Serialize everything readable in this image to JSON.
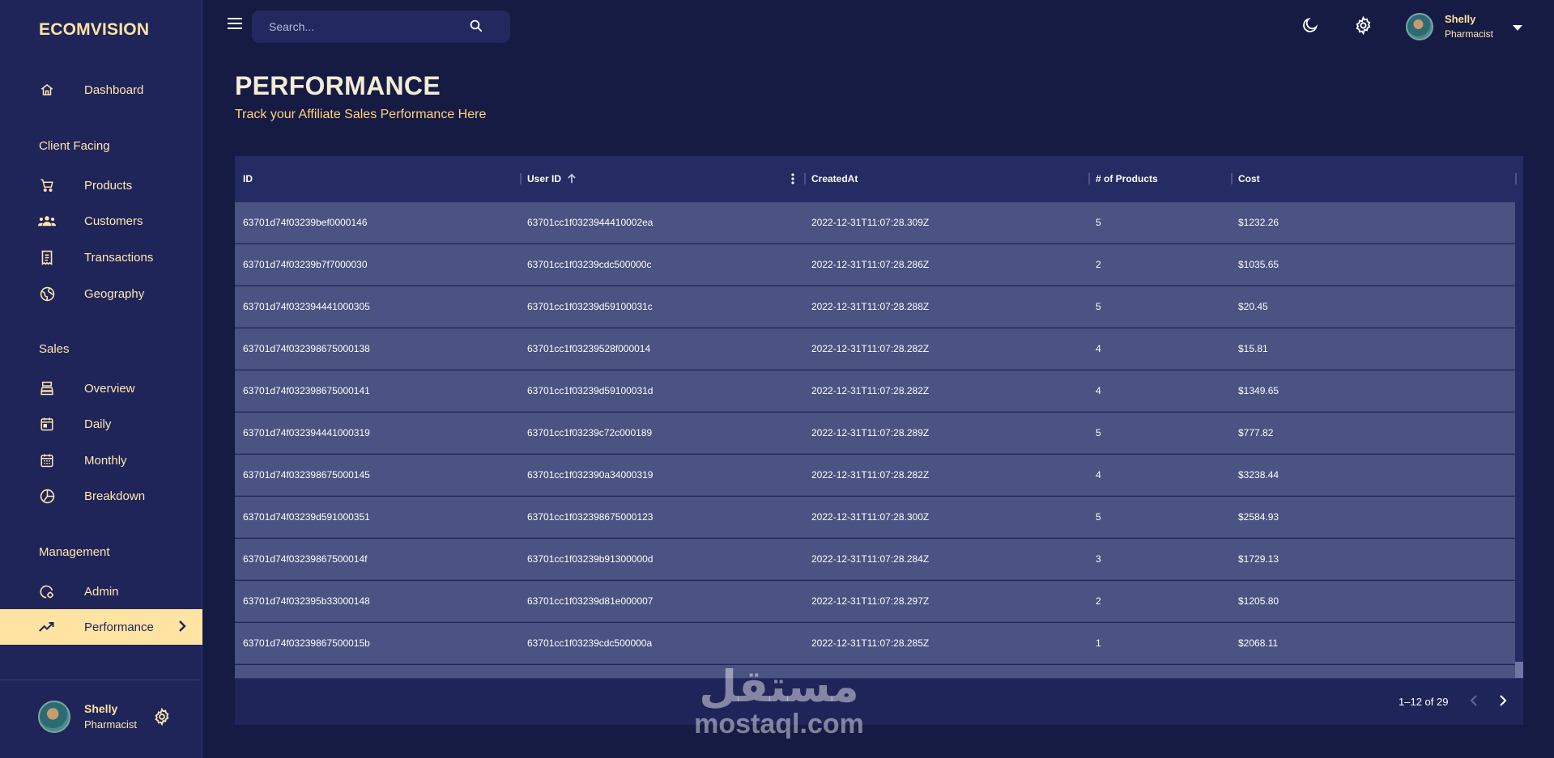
{
  "app": {
    "brand": "ECOMVISION"
  },
  "sidebar": {
    "dashboard": "Dashboard",
    "sections": {
      "client_facing": "Client Facing",
      "sales": "Sales",
      "management": "Management"
    },
    "items": [
      {
        "label": "Dashboard",
        "icon": "home-icon"
      },
      {
        "label": "Products",
        "icon": "shopping-cart-icon"
      },
      {
        "label": "Customers",
        "icon": "groups-icon"
      },
      {
        "label": "Transactions",
        "icon": "receipt-icon"
      },
      {
        "label": "Geography",
        "icon": "globe-icon"
      },
      {
        "label": "Overview",
        "icon": "point-of-sale-icon"
      },
      {
        "label": "Daily",
        "icon": "calendar-day-icon"
      },
      {
        "label": "Monthly",
        "icon": "calendar-month-icon"
      },
      {
        "label": "Breakdown",
        "icon": "pie-chart-icon"
      },
      {
        "label": "Admin",
        "icon": "admin-icon"
      },
      {
        "label": "Performance",
        "icon": "trending-up-icon",
        "active": true
      }
    ],
    "user": {
      "name": "Shelly",
      "role": "Pharmacist"
    }
  },
  "topbar": {
    "search_placeholder": "Search...",
    "user": {
      "name": "Shelly",
      "role": "Pharmacist"
    }
  },
  "header": {
    "title": "PERFORMANCE",
    "subtitle": "Track your Affiliate Sales Performance Here"
  },
  "grid": {
    "columns": [
      "ID",
      "User ID",
      "CreatedAt",
      "# of Products",
      "Cost"
    ],
    "sort": {
      "column": "User ID",
      "direction": "asc"
    },
    "rows": [
      [
        "63701d74f03239bef0000146",
        "63701cc1f0323944410002ea",
        "2022-12-31T11:07:28.309Z",
        "5",
        "$1232.26"
      ],
      [
        "63701d74f03239b7f7000030",
        "63701cc1f03239cdc500000c",
        "2022-12-31T11:07:28.286Z",
        "2",
        "$1035.65"
      ],
      [
        "63701d74f032394441000305",
        "63701cc1f03239d59100031c",
        "2022-12-31T11:07:28.288Z",
        "5",
        "$20.45"
      ],
      [
        "63701d74f032398675000138",
        "63701cc1f03239528f000014",
        "2022-12-31T11:07:28.282Z",
        "4",
        "$15.81"
      ],
      [
        "63701d74f032398675000141",
        "63701cc1f03239d59100031d",
        "2022-12-31T11:07:28.282Z",
        "4",
        "$1349.65"
      ],
      [
        "63701d74f032394441000319",
        "63701cc1f03239c72c000189",
        "2022-12-31T11:07:28.289Z",
        "5",
        "$777.82"
      ],
      [
        "63701d74f032398675000145",
        "63701cc1f032390a34000319",
        "2022-12-31T11:07:28.282Z",
        "4",
        "$3238.44"
      ],
      [
        "63701d74f03239d591000351",
        "63701cc1f032398675000123",
        "2022-12-31T11:07:28.300Z",
        "5",
        "$2584.93"
      ],
      [
        "63701d74f03239867500014f",
        "63701cc1f03239b91300000d",
        "2022-12-31T11:07:28.284Z",
        "3",
        "$1729.13"
      ],
      [
        "63701d74f032395b33000148",
        "63701cc1f03239d81e000007",
        "2022-12-31T11:07:28.297Z",
        "2",
        "$1205.80"
      ],
      [
        "63701d74f03239867500015b",
        "63701cc1f03239cdc500000a",
        "2022-12-31T11:07:28.285Z",
        "1",
        "$2068.11"
      ]
    ],
    "pagination": "1–12 of 29"
  },
  "watermark": {
    "arabic": "مستقل",
    "latin": "mostaql.com"
  },
  "colors": {
    "background": "#161b44",
    "sidebar": "#1f2559",
    "accent": "#ffe3a3",
    "row": "#4a5381"
  }
}
